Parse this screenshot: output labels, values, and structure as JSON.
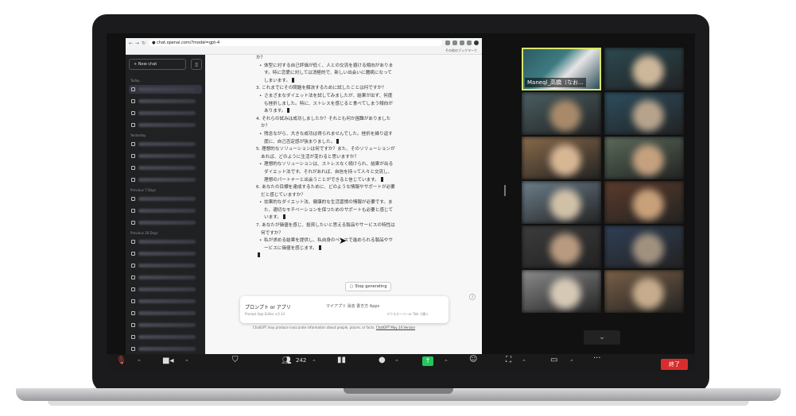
{
  "browser": {
    "url": "chat.openai.com/?model=gpt-4",
    "bookmarks_label": "その他のブックマーク"
  },
  "sidebar": {
    "new_chat": "New chat",
    "groups": [
      "Today",
      "Yesterday",
      "Previous 7 Days",
      "Previous 30 Days"
    ]
  },
  "conversation": {
    "lines": [
      {
        "type": "q",
        "text": "か？"
      },
      {
        "type": "b",
        "text": "体型に対する自己評価が低く、人との交流を避ける傾向がありま"
      },
      {
        "type": "c",
        "text": "す。特に恋愛に対しては消極的で、新しい出会いに臆病になって"
      },
      {
        "type": "c",
        "text": "しまいます。",
        "cursor": true
      },
      {
        "type": "q",
        "text": "3. これまでにその問題を解決するために試したことは何ですか？"
      },
      {
        "type": "b",
        "text": "さまざまなダイエット法を試してみましたが、結果が出ず、何度"
      },
      {
        "type": "c",
        "text": "も挫折しました。特に、ストレスを感じると食べてしまう傾向が"
      },
      {
        "type": "c",
        "text": "あります。",
        "cursor": true
      },
      {
        "type": "q",
        "text": "4. それらの試みは成功しましたか？それとも何か困難がありました"
      },
      {
        "type": "q2",
        "text": "か？"
      },
      {
        "type": "b",
        "text": "残念ながら、大きな成功は得られませんでした。挫折を繰り返す"
      },
      {
        "type": "c",
        "text": "度に、自己否定感が強まりました。",
        "cursor": true
      },
      {
        "type": "q",
        "text": "5. 理想的なソリューションは何ですか？また、そのソリューションが"
      },
      {
        "type": "q2",
        "text": "あれば、どのように生活が変わると思いますか？"
      },
      {
        "type": "b",
        "text": "理想的なソリューションは、ストレスなく続けられ、結果が出る"
      },
      {
        "type": "c",
        "text": "ダイエット法です。それがあれば、自信を持って人々と交流し、"
      },
      {
        "type": "c",
        "text": "理想のパートナーと出会うことができると信じています。",
        "cursor": true
      },
      {
        "type": "q",
        "text": "6. あなたの目標を達成するために、どのような情報やサポートが必要"
      },
      {
        "type": "q2",
        "text": "だと感じていますか？"
      },
      {
        "type": "b",
        "text": "効果的なダイエット法、健康的な生活習慣の情報が必要です。ま"
      },
      {
        "type": "c",
        "text": "た、適切なモチベーションを保つためのサポートも必要と感じて"
      },
      {
        "type": "c",
        "text": "います。",
        "cursor": true
      },
      {
        "type": "q",
        "text": "7. あなたが価値を感じ、投資したいと思える製品やサービスの特性は"
      },
      {
        "type": "q2",
        "text": "何ですか？"
      },
      {
        "type": "b",
        "text": "私が求める結果を提供し、私自身のペースで進められる製品やサ"
      },
      {
        "type": "c",
        "text": "ービスに価値を感じます。",
        "cursor": true
      }
    ],
    "stop_button": "Stop generating",
    "prompt_left": "プロンプト or アプリ",
    "prompt_sub": "Prompt App Editor v.0.14",
    "prompt_right": "マイアプリ  消去  書き方  Apps",
    "prompt_right2": "マウスオーバーor Tab で開く",
    "disclaimer": "ChatGPT may produce inaccurate information about people, places, or facts.",
    "disclaimer_link": "ChatGPT May 24 Version"
  },
  "zoom": {
    "speaker_name": "Maneql_高橋（なお...",
    "participants_count": "242",
    "end_button": "終了"
  },
  "colors": {
    "end_button": "#d92d2d",
    "share_button": "#24c65c",
    "speaker_border": "#d9e66a"
  }
}
